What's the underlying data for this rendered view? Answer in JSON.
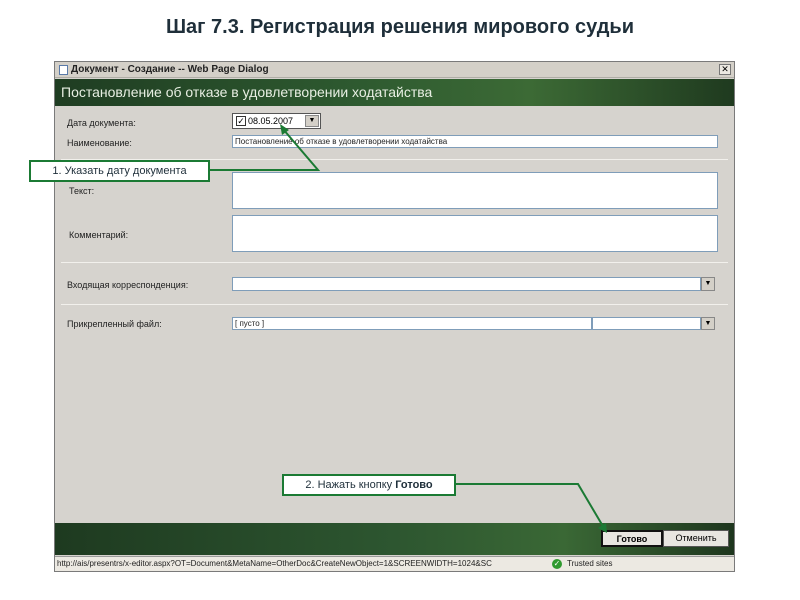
{
  "slide": {
    "title": "Шаг 7.3. Регистрация решения мирового судьи"
  },
  "dialog": {
    "window_title": "Документ - Создание -- Web Page Dialog",
    "close_glyph": "✕",
    "header": "Постановление об отказе в удовлетворении ходатайства",
    "fields": {
      "date_label": "Дата документа:",
      "date_value": "08.05.2007",
      "date_checked_glyph": "✓",
      "name_label": "Наименование:",
      "name_value": "Постановление об отказе в удовлетворении ходатайства",
      "text_label": "Текст:",
      "comment_label": "Комментарий:",
      "incoming_label": "Входящая корреспонденция:",
      "attached_label": "Прикрепленный файл:",
      "attached_value": "[ пусто ]"
    },
    "buttons": {
      "ok": "Готово",
      "cancel": "Отменить"
    },
    "status": {
      "url": "http://ais/presentrs/x-editor.aspx?OT=Document&MetaName=OtherDoc&CreateNewObject=1&SCREENWIDTH=1024&SC",
      "zone": "Trusted sites",
      "zone_glyph": "✓"
    },
    "dropdown_glyph": "▼"
  },
  "callouts": {
    "step1": "1. Указать дату документа",
    "step2_prefix": "2. Нажать кнопку ",
    "step2_bold": "Готово"
  },
  "colors": {
    "callout_border": "#1b7a34",
    "header_band": "#2e5a30"
  }
}
